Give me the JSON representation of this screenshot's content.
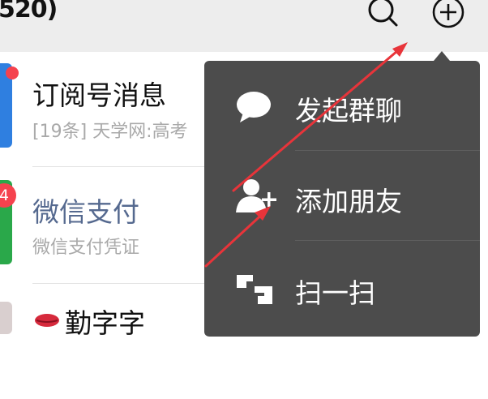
{
  "header": {
    "title": "520)",
    "search_icon": "search-icon",
    "add_icon": "plus-circle-icon"
  },
  "chats": [
    {
      "name": "订阅号消息",
      "preview": "[19条] 天学网:高考",
      "avatar_color": "#2f7fe0",
      "unread_dot": true
    },
    {
      "name": "微信支付",
      "preview": "微信支付凭证",
      "avatar_color": "#2aa84a",
      "badge": "4"
    },
    {
      "name": "勤字字",
      "preview": ""
    }
  ],
  "menu": {
    "items": [
      {
        "label": "发起群聊",
        "icon": "chat-bubble-icon"
      },
      {
        "label": "添加朋友",
        "icon": "add-friend-icon"
      },
      {
        "label": "扫一扫",
        "icon": "scan-icon"
      }
    ]
  },
  "colors": {
    "header_bg": "#ededed",
    "menu_bg": "#4c4c4c",
    "badge": "#f5424e",
    "annotation_arrow": "#e8343a"
  }
}
